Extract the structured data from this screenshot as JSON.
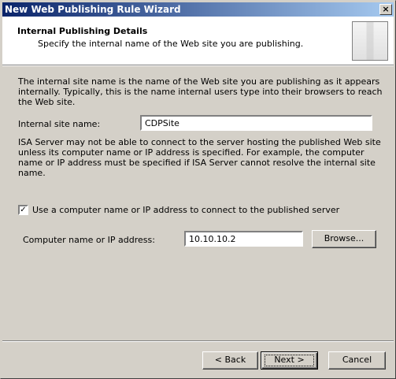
{
  "window": {
    "title": "New Web Publishing Rule Wizard",
    "close_label": "×"
  },
  "header": {
    "title": "Internal Publishing Details",
    "subtitle": "Specify the internal name of the Web site you are publishing."
  },
  "body": {
    "intro": "The internal site name is the name of the Web site you are publishing as it appears internally. Typically, this is the name internal users type into their browsers to reach the Web site.",
    "site_name_label": "Internal site name:",
    "site_name_value": "CDPSite",
    "note": "ISA Server may not be able to connect to the server hosting the published Web site unless its computer name or IP address is specified. For example, the computer name or IP address must be specified if ISA Server cannot resolve the internal site name.",
    "use_ip_checked_mark": "✓",
    "use_ip_label": "Use a computer name or IP address to connect to the published server",
    "computer_label": "Computer name or IP address:",
    "computer_value": "10.10.10.2",
    "browse_label": "Browse..."
  },
  "footer": {
    "back_label": "< Back",
    "next_label": "Next >",
    "cancel_label": "Cancel"
  }
}
